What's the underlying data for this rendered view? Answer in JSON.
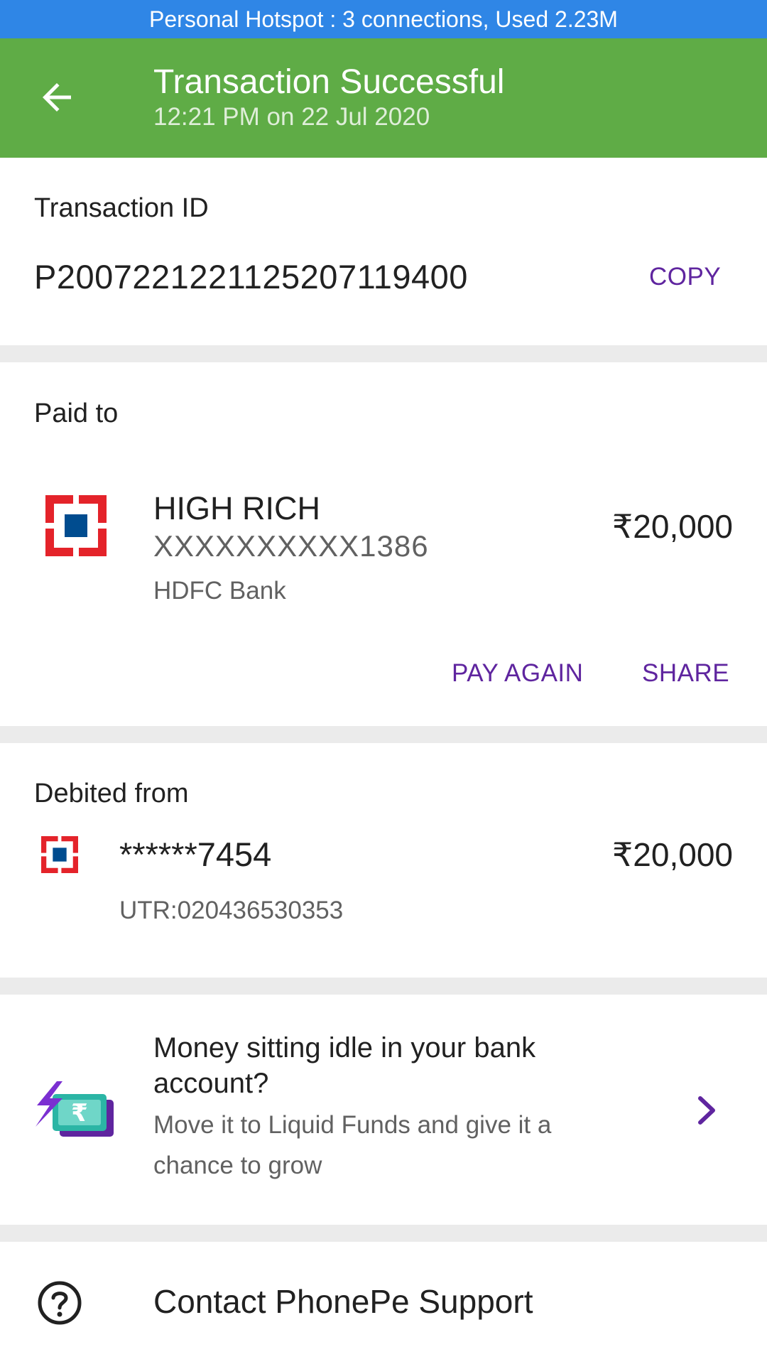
{
  "status_bar": {
    "text": "Personal Hotspot : 3 connections, Used 2.23M",
    "color": "#2f86e6"
  },
  "header": {
    "title": "Transaction Successful",
    "subtitle": "12:21 PM on 22 Jul 2020",
    "back_icon": "arrow-left-icon",
    "color": "#5fac46"
  },
  "transaction": {
    "label": "Transaction ID",
    "id": "P2007221221125207119400",
    "copy_label": "COPY"
  },
  "paid_to": {
    "label": "Paid to",
    "name": "HIGH RICH",
    "account": "XXXXXXXXXX1386",
    "bank": "HDFC Bank",
    "amount": "₹20,000",
    "logo_icon": "hdfc-bank-logo-icon",
    "pay_again_label": "PAY AGAIN",
    "share_label": "SHARE"
  },
  "debited_from": {
    "label": "Debited from",
    "account": "******7454",
    "utr": "UTR:020436530353",
    "amount": "₹20,000",
    "logo_icon": "hdfc-bank-logo-icon"
  },
  "promo": {
    "title": "Money sitting idle in your bank account?",
    "subtitle": "Move it to Liquid Funds and give it a chance to grow",
    "icon": "money-rupee-icon",
    "chevron_icon": "chevron-right-icon"
  },
  "support": {
    "label": "Contact PhonePe Support",
    "icon": "help-circle-icon"
  },
  "colors": {
    "accent": "#5f259f",
    "hdfc_red": "#e4232a",
    "hdfc_blue": "#004c8f",
    "divider": "#ebebeb"
  }
}
